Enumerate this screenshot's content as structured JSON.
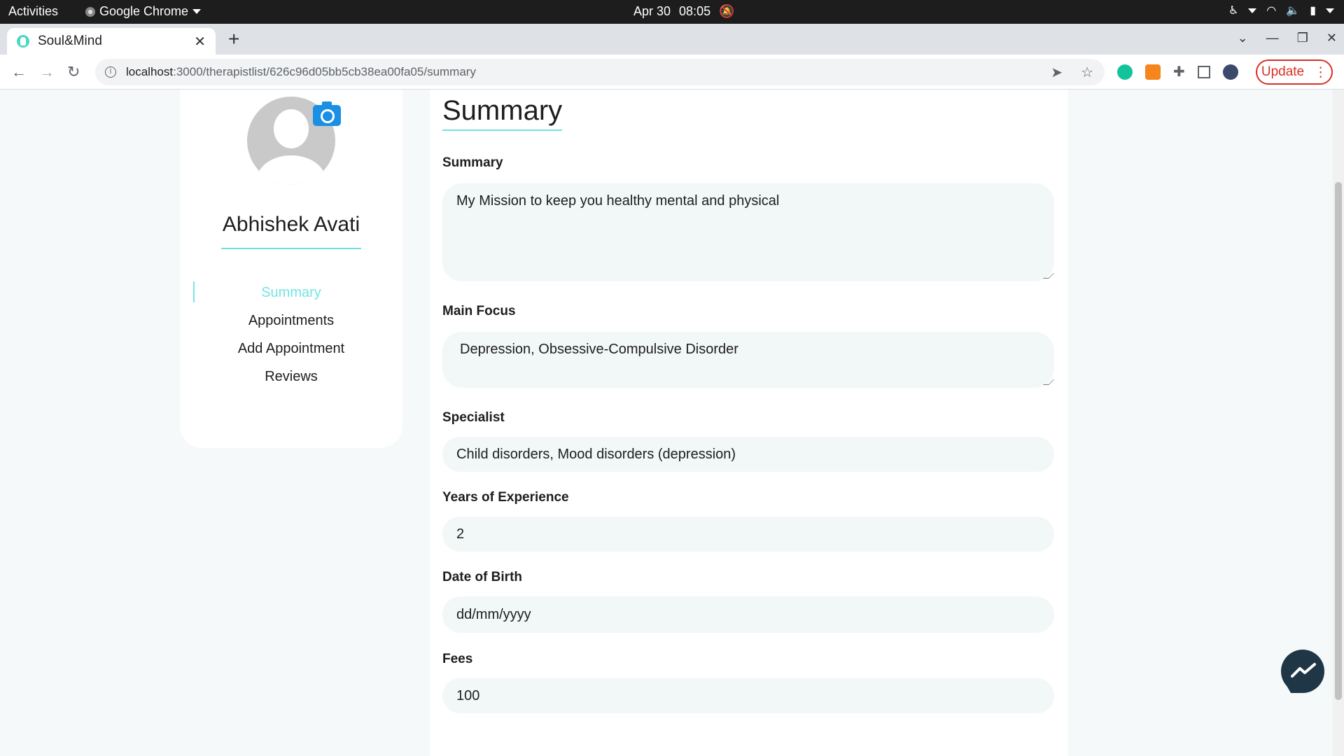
{
  "system_bar": {
    "activities": "Activities",
    "app_name": "Google Chrome",
    "date": "Apr 30",
    "time": "08:05"
  },
  "browser": {
    "tab_title": "Soul&Mind",
    "url_host": "localhost",
    "url_path": ":3000/therapistlist/626c96d05bb5cb38ea00fa05/summary",
    "update_label": "Update"
  },
  "sidebar": {
    "name": "Abhishek Avati",
    "nav": [
      {
        "label": "Summary",
        "active": true
      },
      {
        "label": "Appointments",
        "active": false
      },
      {
        "label": "Add Appointment",
        "active": false
      },
      {
        "label": "Reviews",
        "active": false
      }
    ]
  },
  "form": {
    "section_title": "Summary",
    "summary_label": "Summary",
    "summary_value": "My Mission to keep you healthy mental and physical",
    "main_focus_label": "Main Focus",
    "main_focus_value": "Depression, Obsessive-Compulsive Disorder",
    "specialist_label": "Specialist",
    "specialist_value": "Child disorders, Mood disorders (depression)",
    "experience_label": "Years of Experience",
    "experience_value": "2",
    "dob_label": "Date of Birth",
    "dob_placeholder": "dd/mm/yyyy",
    "fees_label": "Fees",
    "fees_value": "100"
  },
  "colors": {
    "accent": "#76e4e4",
    "update_red": "#d93025",
    "messenger_bg": "#1f3646"
  }
}
